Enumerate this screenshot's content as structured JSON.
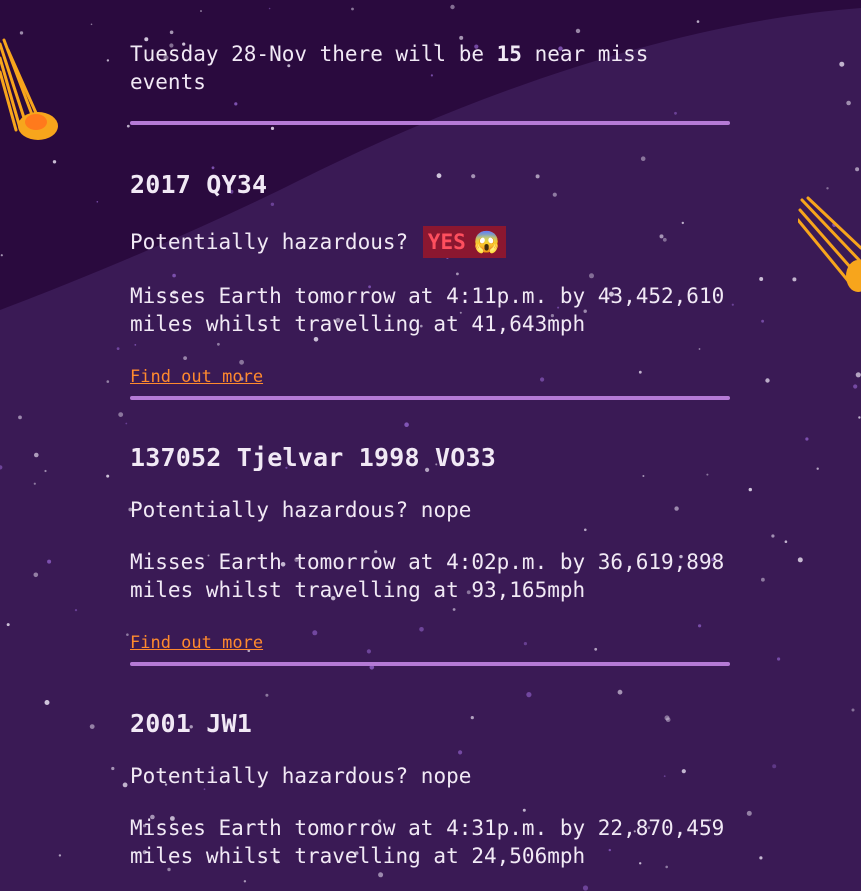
{
  "intro": {
    "prefix": "Tuesday 28-Nov there will be ",
    "count": "15",
    "suffix": " near miss events"
  },
  "events": [
    {
      "name": "2017 QY34",
      "hazard_label": "Potentially hazardous? ",
      "hazard_value": "YES",
      "hazard_emoji": "😱",
      "miss_text": "Misses Earth tomorrow at 4:11p.m. by 43,452,610 miles whilst travelling at 41,643mph",
      "link_text": "Find out more"
    },
    {
      "name": "137052 Tjelvar 1998 VO33",
      "hazard_label": "Potentially hazardous? ",
      "hazard_value": "nope",
      "miss_text": "Misses Earth tomorrow at 4:02p.m. by 36,619,898 miles whilst travelling at 93,165mph",
      "link_text": "Find out more"
    },
    {
      "name": "2001 JW1",
      "hazard_label": "Potentially hazardous? ",
      "hazard_value": "nope",
      "miss_text": "Misses Earth tomorrow at 4:31p.m. by 22,870,459 miles whilst travelling at 24,506mph"
    }
  ],
  "colors": {
    "background": "#2b0f3f",
    "divider": "#b57ad6",
    "link": "#ff8a2e",
    "hazard_badge_bg": "#8b1730",
    "hazard_badge_text": "#ff4f5e",
    "comet": "#f7a51c"
  }
}
